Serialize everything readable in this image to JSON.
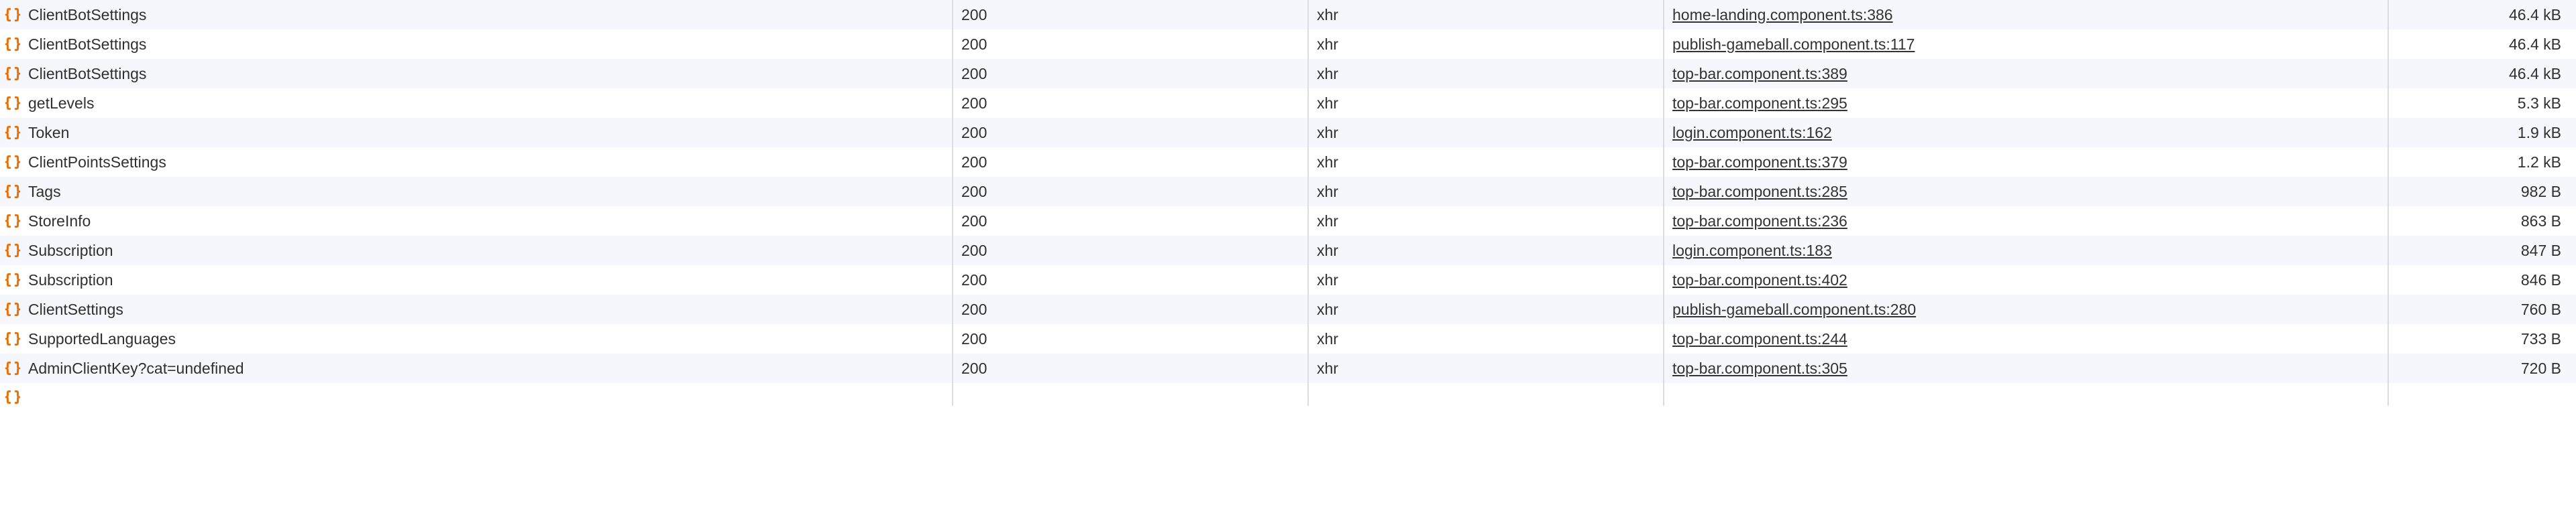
{
  "requests": [
    {
      "name": "ClientBotSettings",
      "status": "200",
      "type": "xhr",
      "initiator": "home-landing.component.ts:386",
      "size": "46.4 kB"
    },
    {
      "name": "ClientBotSettings",
      "status": "200",
      "type": "xhr",
      "initiator": "publish-gameball.component.ts:117",
      "size": "46.4 kB"
    },
    {
      "name": "ClientBotSettings",
      "status": "200",
      "type": "xhr",
      "initiator": "top-bar.component.ts:389",
      "size": "46.4 kB"
    },
    {
      "name": "getLevels",
      "status": "200",
      "type": "xhr",
      "initiator": "top-bar.component.ts:295",
      "size": "5.3 kB"
    },
    {
      "name": "Token",
      "status": "200",
      "type": "xhr",
      "initiator": "login.component.ts:162",
      "size": "1.9 kB"
    },
    {
      "name": "ClientPointsSettings",
      "status": "200",
      "type": "xhr",
      "initiator": "top-bar.component.ts:379",
      "size": "1.2 kB"
    },
    {
      "name": "Tags",
      "status": "200",
      "type": "xhr",
      "initiator": "top-bar.component.ts:285",
      "size": "982 B"
    },
    {
      "name": "StoreInfo",
      "status": "200",
      "type": "xhr",
      "initiator": "top-bar.component.ts:236",
      "size": "863 B"
    },
    {
      "name": "Subscription",
      "status": "200",
      "type": "xhr",
      "initiator": "login.component.ts:183",
      "size": "847 B"
    },
    {
      "name": "Subscription",
      "status": "200",
      "type": "xhr",
      "initiator": "top-bar.component.ts:402",
      "size": "846 B"
    },
    {
      "name": "ClientSettings",
      "status": "200",
      "type": "xhr",
      "initiator": "publish-gameball.component.ts:280",
      "size": "760 B"
    },
    {
      "name": "SupportedLanguages",
      "status": "200",
      "type": "xhr",
      "initiator": "top-bar.component.ts:244",
      "size": "733 B"
    },
    {
      "name": "AdminClientKey?cat=undefined",
      "status": "200",
      "type": "xhr",
      "initiator": "top-bar.component.ts:305",
      "size": "720 B"
    }
  ]
}
